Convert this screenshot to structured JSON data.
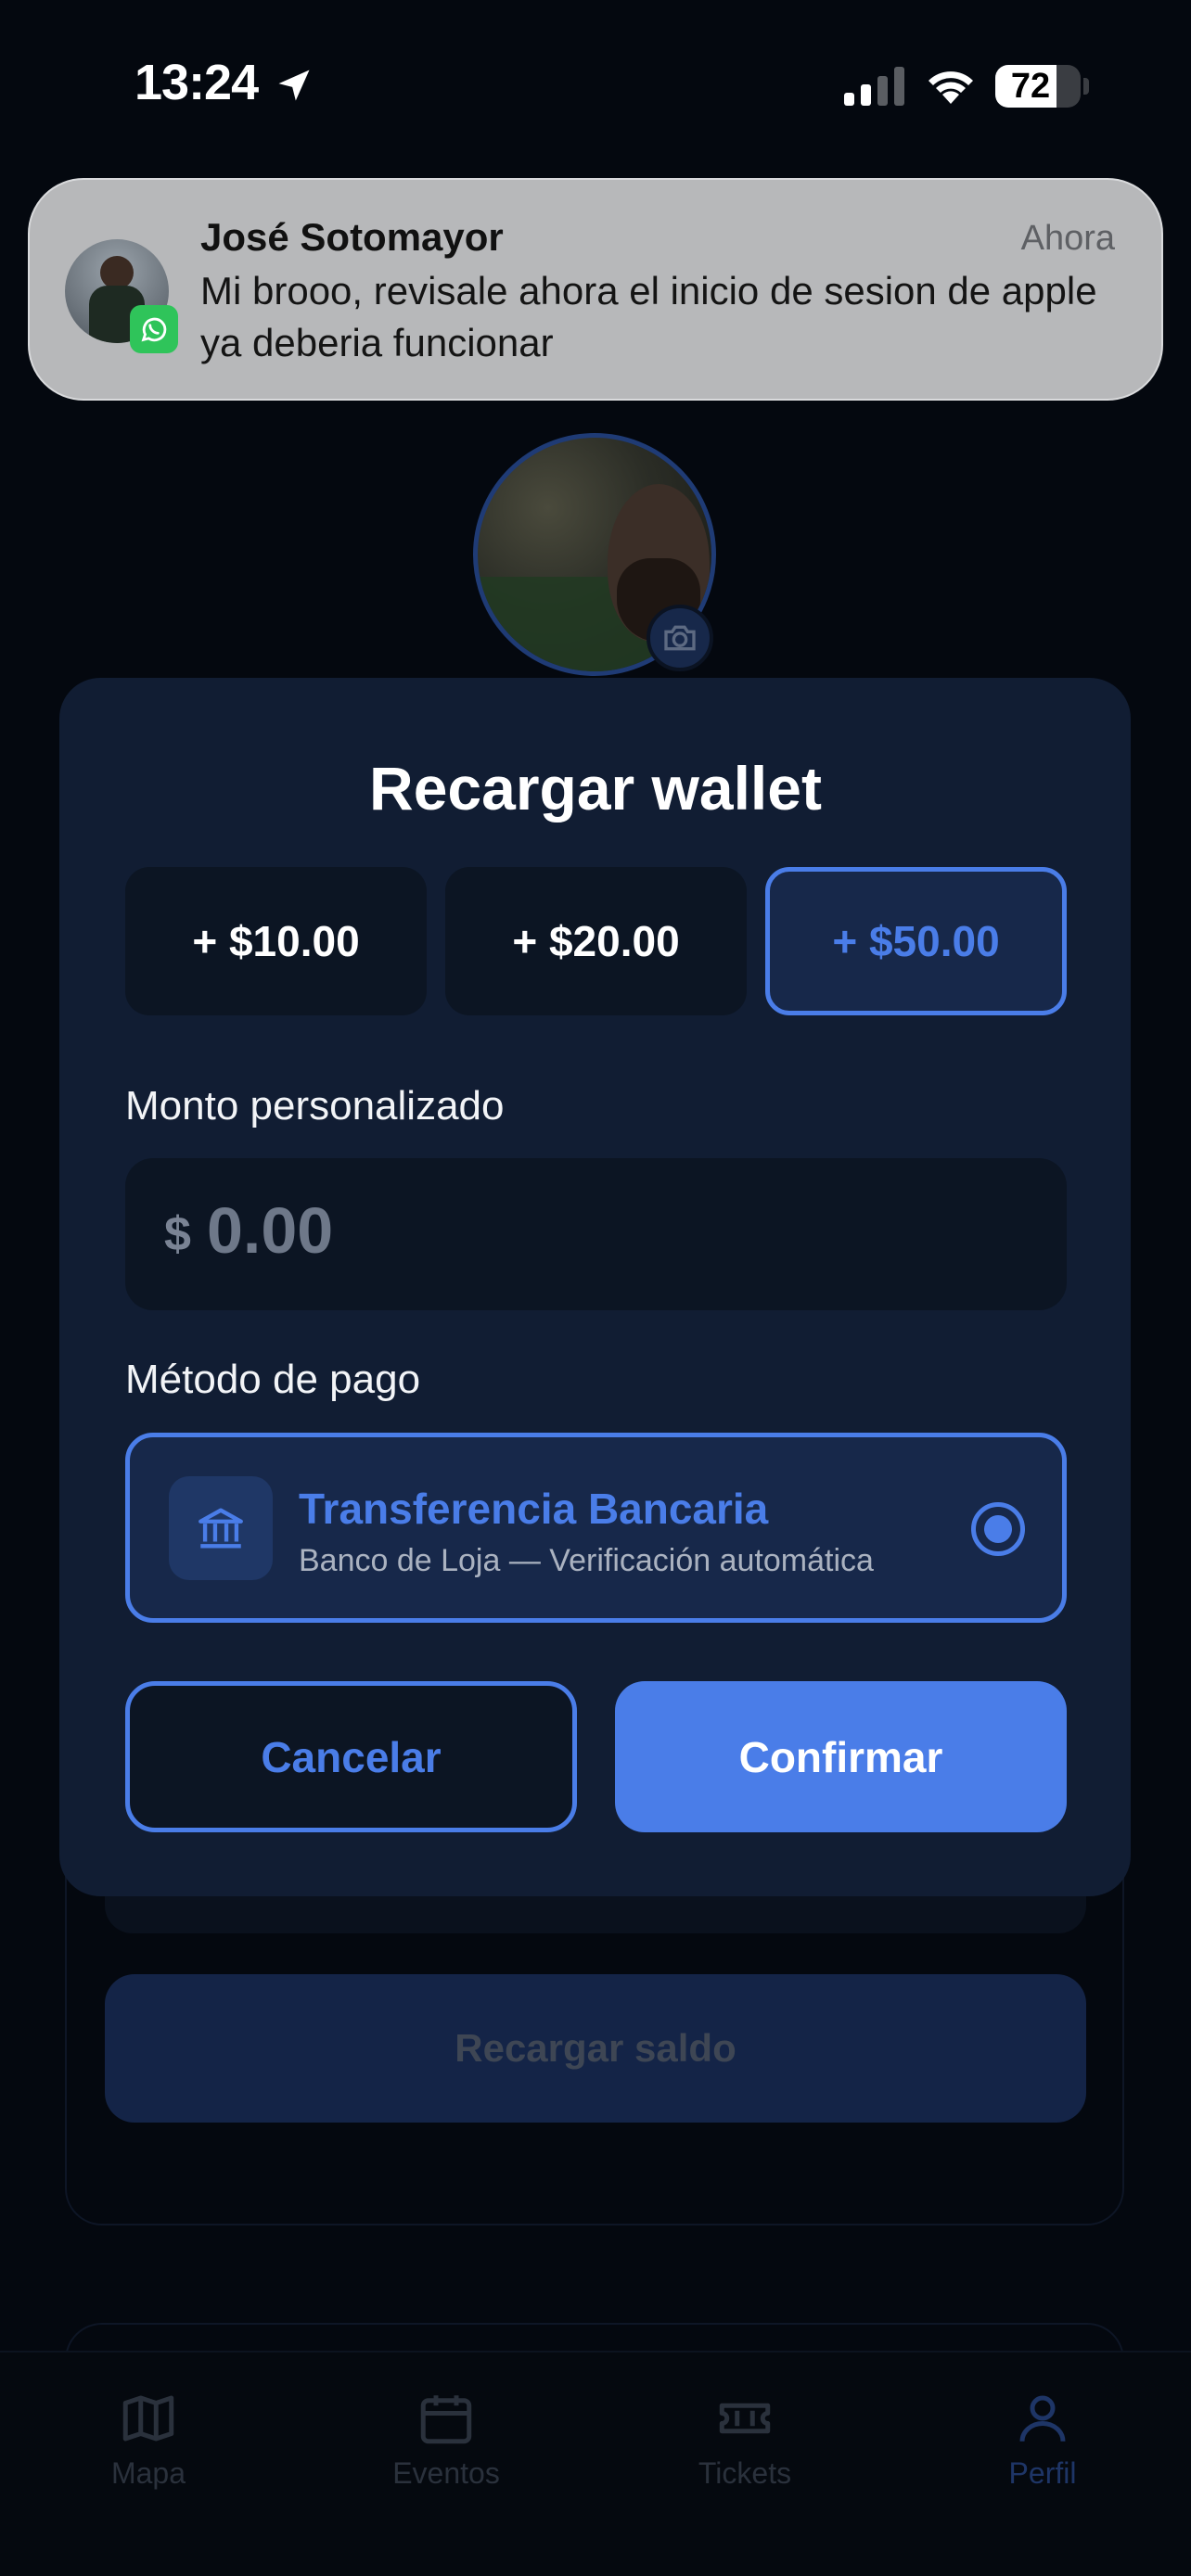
{
  "status_bar": {
    "time": "13:24",
    "battery_percent": "72",
    "battery_level": 0.72
  },
  "notification": {
    "sender": "José Sotomayor",
    "time": "Ahora",
    "message": "Mi brooo, revisale ahora el inicio de sesion de apple ya deberia funcionar",
    "app_icon": "whatsapp-icon"
  },
  "background": {
    "recharge_button_label": "Recargar saldo"
  },
  "modal": {
    "title": "Recargar wallet",
    "amounts": [
      {
        "label": "+ $10.00",
        "selected": false
      },
      {
        "label": "+ $20.00",
        "selected": false
      },
      {
        "label": "+ $50.00",
        "selected": true
      }
    ],
    "custom_amount": {
      "label": "Monto personalizado",
      "currency_symbol": "$",
      "placeholder": "0.00",
      "value": ""
    },
    "payment_method": {
      "label": "Método de pago",
      "title": "Transferencia Bancaria",
      "subtitle": "Banco de Loja — Verificación automática",
      "icon": "bank-icon",
      "selected": true
    },
    "cancel_label": "Cancelar",
    "confirm_label": "Confirmar"
  },
  "tab_bar": {
    "tabs": [
      {
        "label": "Mapa",
        "icon": "map-icon",
        "active": false
      },
      {
        "label": "Eventos",
        "icon": "calendar-icon",
        "active": false
      },
      {
        "label": "Tickets",
        "icon": "ticket-icon",
        "active": false
      },
      {
        "label": "Perfil",
        "icon": "person-icon",
        "active": true
      }
    ]
  },
  "colors": {
    "accent": "#4a7de8",
    "modal_bg": "#111d33",
    "page_bg": "#04080f"
  }
}
